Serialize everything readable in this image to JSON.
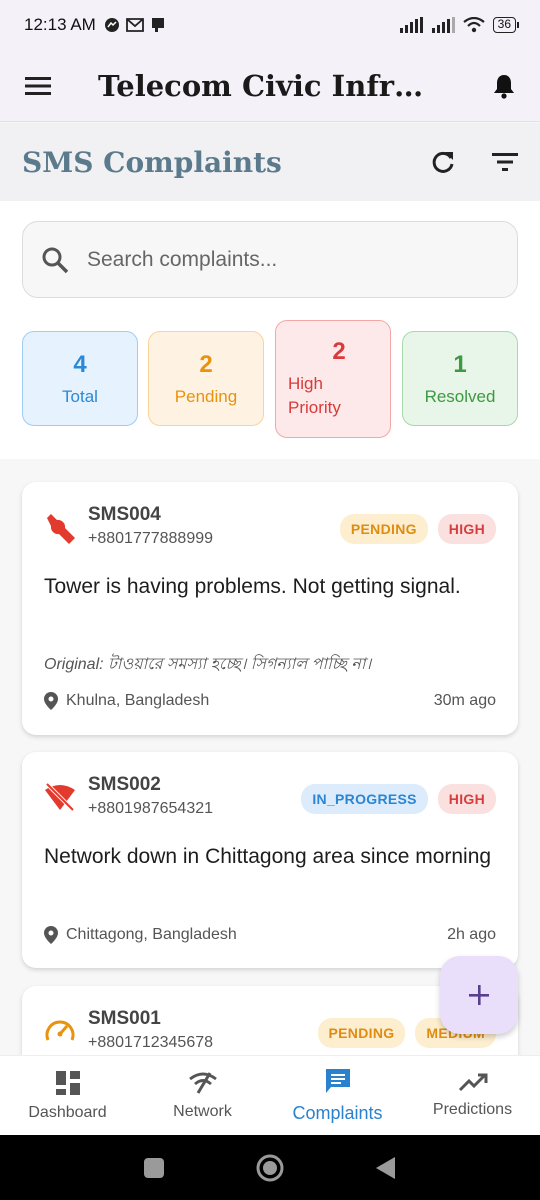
{
  "status_bar": {
    "time": "12:13 AM",
    "battery": "36"
  },
  "app_bar": {
    "title": "Telecom Civic Infrastr..."
  },
  "sub_header": {
    "title": "SMS Complaints"
  },
  "search": {
    "placeholder": "Search complaints..."
  },
  "stats": {
    "total": {
      "value": "4",
      "label": "Total"
    },
    "pending": {
      "value": "2",
      "label": "Pending"
    },
    "high": {
      "value": "2",
      "label": "High Priority"
    },
    "resolved": {
      "value": "1",
      "label": "Resolved"
    }
  },
  "complaints": [
    {
      "id": "SMS004",
      "phone": "+8801777888999",
      "status": "PENDING",
      "priority": "HIGH",
      "message": "Tower is having problems. Not getting signal.",
      "original": "Original: টাওয়ারে সমস্যা হচ্ছে। সিগন্যাল পাচ্ছি না।",
      "location": "Khulna, Bangladesh",
      "time": "30m ago",
      "icon": "wrench-icon"
    },
    {
      "id": "SMS002",
      "phone": "+8801987654321",
      "status": "IN_PROGRESS",
      "priority": "HIGH",
      "message": "Network down in Chittagong area since morning",
      "location": "Chittagong, Bangladesh",
      "time": "2h ago",
      "icon": "no-signal-icon"
    },
    {
      "id": "SMS001",
      "phone": "+8801712345678",
      "status": "PENDING",
      "priority": "MEDIUM",
      "icon": "speed-icon"
    }
  ],
  "bottom_nav": [
    {
      "label": "Dashboard",
      "icon": "dashboard-icon"
    },
    {
      "label": "Network",
      "icon": "network-icon"
    },
    {
      "label": "Complaints",
      "icon": "message-icon",
      "active": true
    },
    {
      "label": "Predictions",
      "icon": "trending-icon"
    }
  ],
  "colors": {
    "accent": "#2a82cf",
    "high": "#d83d3d",
    "pending": "#e08c10",
    "resolved": "#3d9942"
  }
}
